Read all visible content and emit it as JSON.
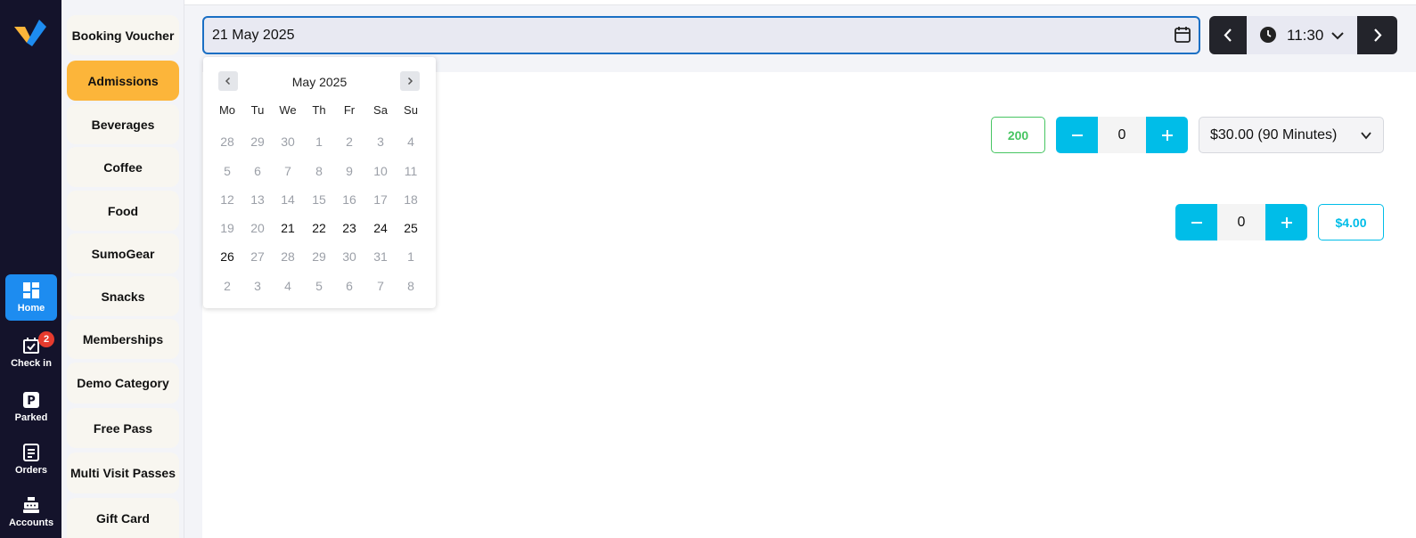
{
  "rail": {
    "items": [
      {
        "label": "Home",
        "icon": "dashboard-icon",
        "active": true
      },
      {
        "label": "Check in",
        "icon": "calendar-check-icon",
        "badge": "2"
      },
      {
        "label": "Parked",
        "icon": "parking-icon"
      },
      {
        "label": "Orders",
        "icon": "receipt-icon"
      },
      {
        "label": "Accounts",
        "icon": "cash-register-icon"
      }
    ]
  },
  "categories": [
    "Booking Voucher",
    "Admissions",
    "Beverages",
    "Coffee",
    "Food",
    "SumoGear",
    "Snacks",
    "Memberships",
    "Demo Category",
    "Free Pass",
    "Multi Visit Passes",
    "Gift Card"
  ],
  "active_category": "Admissions",
  "date_field": {
    "value": "21 May 2025"
  },
  "time_picker": {
    "value": "11:30"
  },
  "datepicker": {
    "title": "May 2025",
    "weekdays": [
      "Mo",
      "Tu",
      "We",
      "Th",
      "Fr",
      "Sa",
      "Su"
    ],
    "weeks": [
      [
        "28",
        "29",
        "30",
        "1",
        "2",
        "3",
        "4"
      ],
      [
        "5",
        "6",
        "7",
        "8",
        "9",
        "10",
        "11"
      ],
      [
        "12",
        "13",
        "14",
        "15",
        "16",
        "17",
        "18"
      ],
      [
        "19",
        "20",
        "21",
        "22",
        "23",
        "24",
        "25"
      ],
      [
        "26",
        "27",
        "28",
        "29",
        "30",
        "31",
        "1"
      ],
      [
        "2",
        "3",
        "4",
        "5",
        "6",
        "7",
        "8"
      ]
    ],
    "enabled_days": [
      "21",
      "22",
      "23",
      "24",
      "25",
      "26"
    ]
  },
  "products": [
    {
      "stock": "200",
      "quantity": "0",
      "price_option": "$30.00 (90 Minutes)"
    },
    {
      "quantity": "0",
      "price": "$4.00"
    }
  ],
  "colors": {
    "rail_bg": "#14132b",
    "accent_blue": "#1d8cf0",
    "category_active": "#fcb53a",
    "stepper": "#00bde8",
    "stock_green": "#47c562"
  }
}
